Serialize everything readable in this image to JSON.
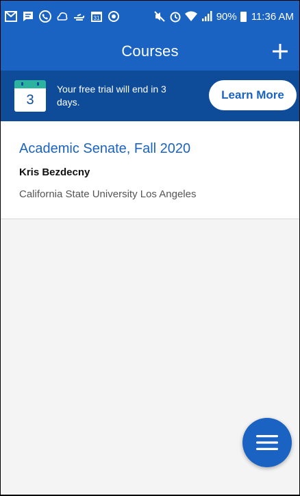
{
  "status_bar": {
    "battery_percent": "90%",
    "time": "11:36 AM",
    "left_icons": [
      "mail-icon",
      "message-icon",
      "phone-icon",
      "weather-icon",
      "wind-icon",
      "calendar-31-icon",
      "sync-icon"
    ],
    "right_icons": [
      "mute-icon",
      "alarm-icon",
      "wifi-icon",
      "signal-icon",
      "battery-icon"
    ]
  },
  "app_bar": {
    "title": "Courses",
    "add_icon": "plus-icon"
  },
  "trial_banner": {
    "calendar_day": "3",
    "message": "Your free trial will end in 3 days.",
    "button_label": "Learn More"
  },
  "course": {
    "title": "Academic Senate, Fall 2020",
    "instructor": "Kris Bezdecny",
    "school": "California State University Los Angeles"
  },
  "fab": {
    "icon": "hamburger-menu-icon"
  },
  "colors": {
    "primary": "#1a63c2",
    "banner": "#0e4c9a",
    "calendar_accent": "#2bb3a0",
    "background": "#f4f4f4"
  }
}
